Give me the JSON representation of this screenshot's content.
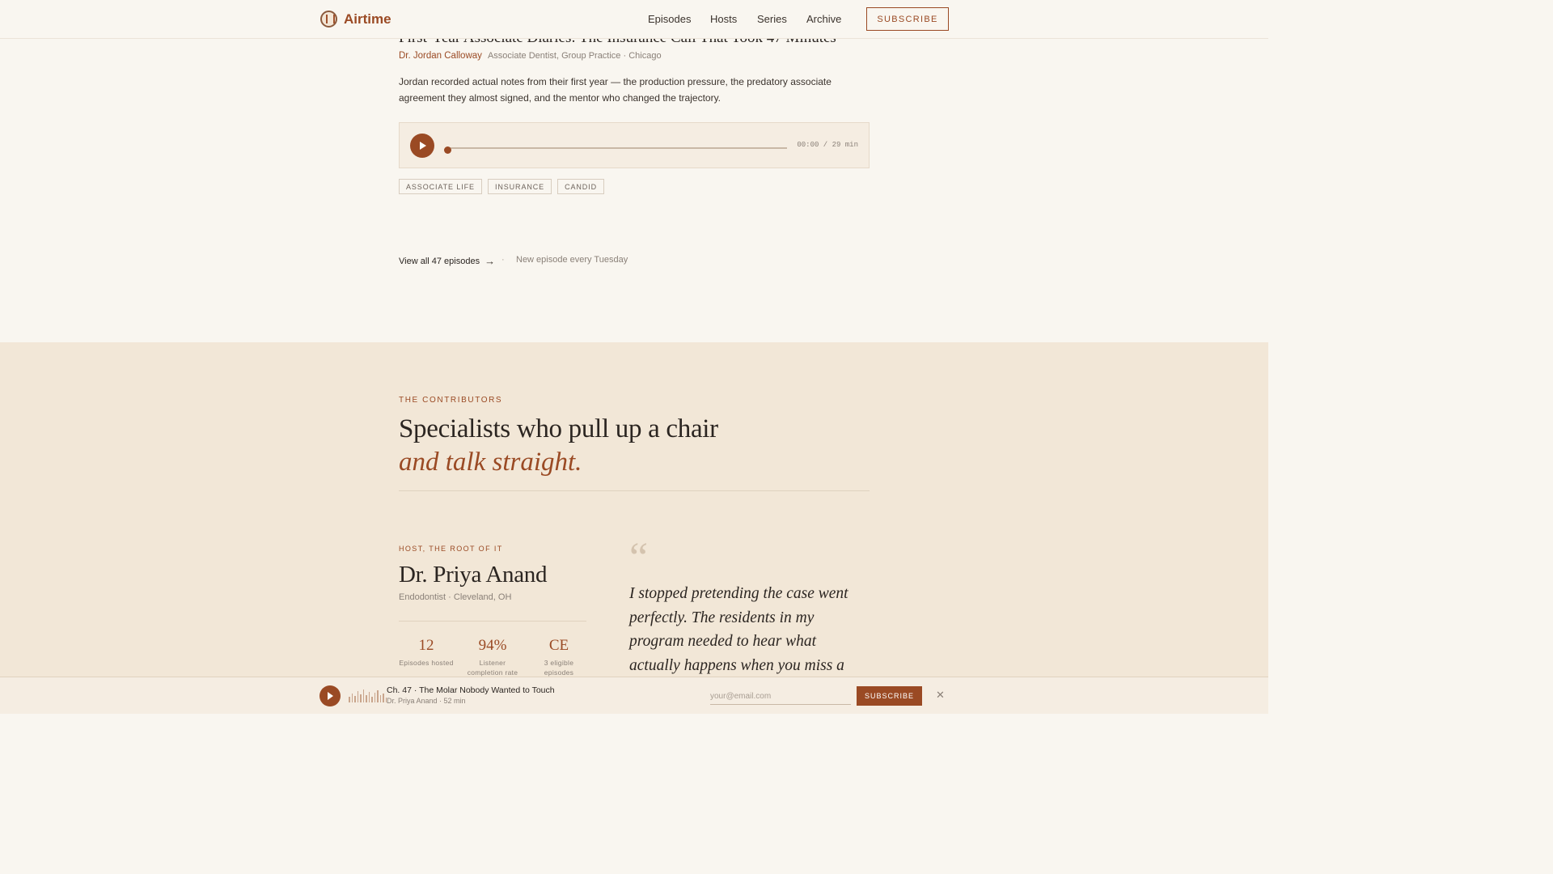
{
  "header": {
    "logo_text": "Airtime",
    "nav": [
      "Episodes",
      "Hosts",
      "Series",
      "Archive"
    ],
    "subscribe_label": "SUBSCRIBE"
  },
  "episode": {
    "title": "First-Year Associate Diaries: The Insurance Call That Took 47 Minutes",
    "author": "Dr. Jordan Calloway",
    "role": "Associate Dentist, Group Practice · Chicago",
    "description": "Jordan recorded actual notes from their first year — the production pressure, the predatory associate agreement they almost signed, and the mentor who changed the trajectory.",
    "player": {
      "time": "00:00 / 29 min",
      "progress": 0
    },
    "tags": [
      "ASSOCIATE LIFE",
      "INSURANCE",
      "CANDID"
    ]
  },
  "episodes_footer": {
    "view_all": "View all 47 episodes",
    "separator": "·",
    "cadence": "New episode every Tuesday"
  },
  "contributors": {
    "eyebrow": "THE CONTRIBUTORS",
    "headline": "Specialists who pull up a chair",
    "headline_em": "and talk straight.",
    "host": {
      "eyebrow": "HOST, THE ROOT OF IT",
      "name": "Dr. Priya Anand",
      "location": "Endodontist · Cleveland, OH",
      "stats": [
        {
          "value": "12",
          "label": "Episodes hosted"
        },
        {
          "value": "94%",
          "label": "Listener completion rate"
        },
        {
          "value": "CE",
          "label": "3 eligible episodes"
        }
      ],
      "quote_mark": "“",
      "quote": "I stopped pretending the case went perfectly. The residents in my program needed to hear what actually happens when you miss a"
    }
  },
  "bottom_bar": {
    "title": "Ch. 47 · The Molar Nobody Wanted to Touch",
    "subtitle": "Dr. Priya Anand · 52 min",
    "email_placeholder": "your@email.com",
    "subscribe_label": "SUBSCRIBE",
    "close_icon": "close-icon"
  },
  "colors": {
    "accent": "#9a4a24",
    "background": "#f9f6f0",
    "section_bg": "#f2e7d7",
    "text": "#2b2521"
  }
}
